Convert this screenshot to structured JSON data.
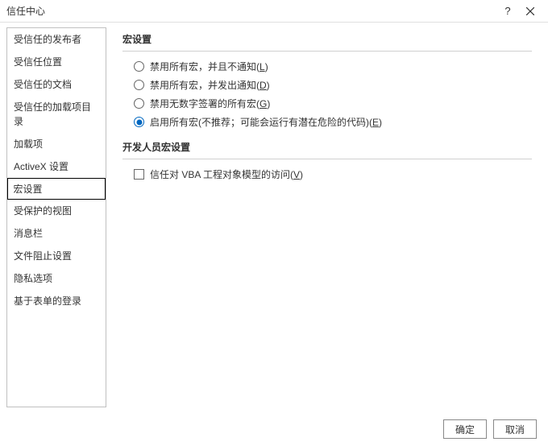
{
  "titlebar": {
    "title": "信任中心",
    "help": "?",
    "close": "×"
  },
  "sidebar": {
    "items": [
      {
        "label": "受信任的发布者"
      },
      {
        "label": "受信任位置"
      },
      {
        "label": "受信任的文档"
      },
      {
        "label": "受信任的加载项目录"
      },
      {
        "label": "加载项"
      },
      {
        "label": "ActiveX 设置"
      },
      {
        "label": "宏设置"
      },
      {
        "label": "受保护的视图"
      },
      {
        "label": "消息栏"
      },
      {
        "label": "文件阻止设置"
      },
      {
        "label": "隐私选项"
      },
      {
        "label": "基于表单的登录"
      }
    ],
    "selectedIndex": 6
  },
  "main": {
    "section1": {
      "title": "宏设置",
      "options": [
        {
          "text": "禁用所有宏，并且不通知",
          "key": "L"
        },
        {
          "text": "禁用所有宏，并发出通知",
          "key": "D"
        },
        {
          "text": "禁用无数字签署的所有宏",
          "key": "G"
        },
        {
          "text": "启用所有宏(不推荐；可能会运行有潜在危险的代码)",
          "key": "E"
        }
      ],
      "selectedIndex": 3
    },
    "section2": {
      "title": "开发人员宏设置",
      "checkbox": {
        "text": "信任对 VBA 工程对象模型的访问",
        "key": "V",
        "checked": false
      }
    }
  },
  "footer": {
    "ok": "确定",
    "cancel": "取消"
  }
}
